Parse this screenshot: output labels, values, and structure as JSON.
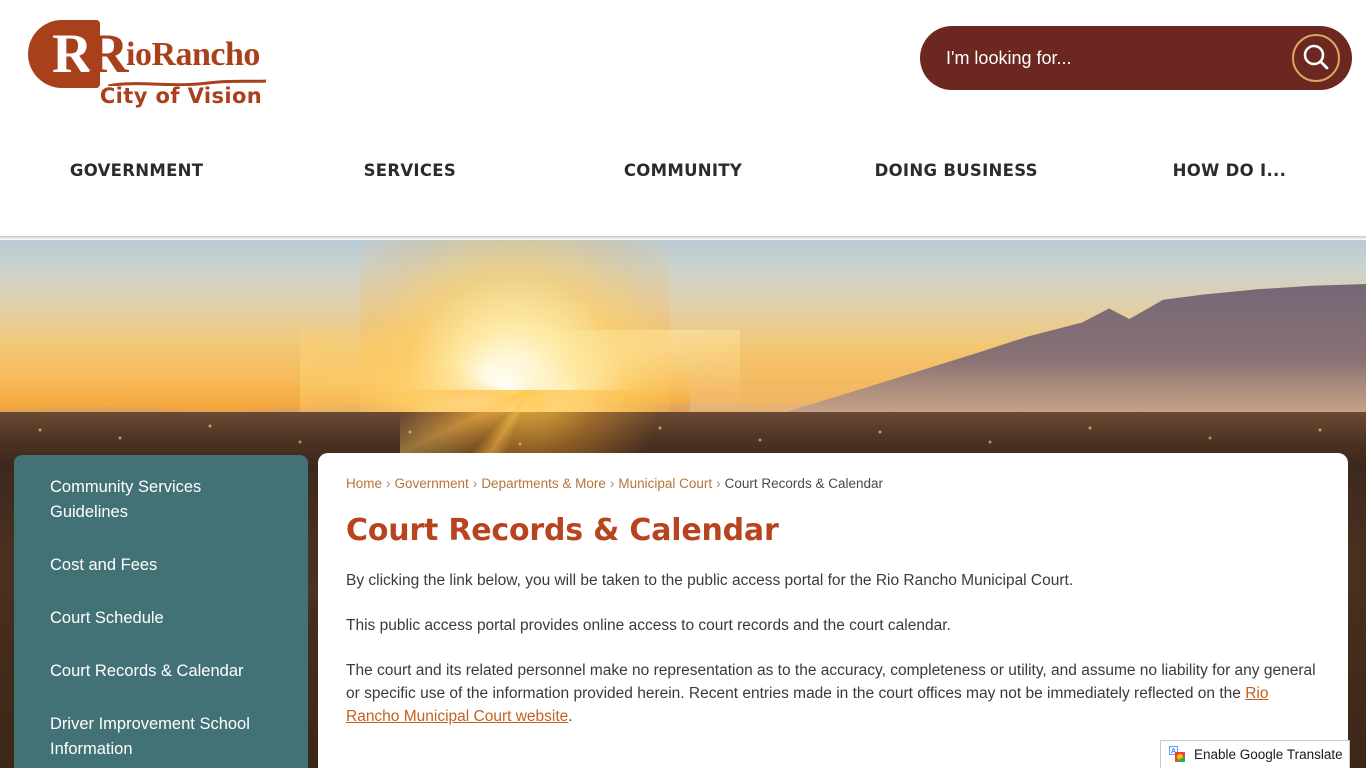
{
  "site": {
    "logo": {
      "mark_letter": "R",
      "mark_letter_2": "R",
      "wordmark": "ioRancho",
      "tagline": "City of Vision",
      "brand_color": "#a8411b"
    }
  },
  "search": {
    "placeholder": "I'm looking for...",
    "value": "",
    "icon": "search-icon",
    "bar_color": "#6b2720",
    "icon_ring_color": "#d9a85c"
  },
  "nav": {
    "items": [
      {
        "label": "GOVERNMENT"
      },
      {
        "label": "SERVICES"
      },
      {
        "label": "COMMUNITY"
      },
      {
        "label": "DOING BUSINESS"
      },
      {
        "label": "HOW DO I..."
      }
    ]
  },
  "sidebar": {
    "background_color": "#437276",
    "items": [
      {
        "label": "Community Services Guidelines"
      },
      {
        "label": "Cost and Fees"
      },
      {
        "label": "Court Schedule"
      },
      {
        "label": "Court Records & Calendar"
      },
      {
        "label": "Driver Improvement School Information"
      }
    ]
  },
  "breadcrumb": {
    "separator": "›",
    "items": [
      {
        "label": "Home",
        "current": false
      },
      {
        "label": "Government",
        "current": false
      },
      {
        "label": "Departments & More",
        "current": false
      },
      {
        "label": "Municipal Court",
        "current": false
      },
      {
        "label": "Court Records & Calendar",
        "current": true
      }
    ]
  },
  "main": {
    "title": "Court Records & Calendar",
    "title_color": "#b8441f",
    "paragraph_1": "By clicking the link below, you will be taken to the public access portal for the Rio Rancho Municipal Court.",
    "paragraph_2": "This public access portal provides online access to court records and the court calendar.",
    "paragraph_3_part_1": "The court and its related personnel make no representation as to the accuracy, completeness or utility, and assume no liability for any general or specific use of the information provided herein. Recent entries made in the court offices may not be immediately reflected on the ",
    "paragraph_3_link": "Rio Rancho Municipal Court website",
    "paragraph_3_part_2": ".",
    "link_color": "#c4601f"
  },
  "google_translate": {
    "label": "Enable Google Translate",
    "icon": "google-translate-icon"
  }
}
